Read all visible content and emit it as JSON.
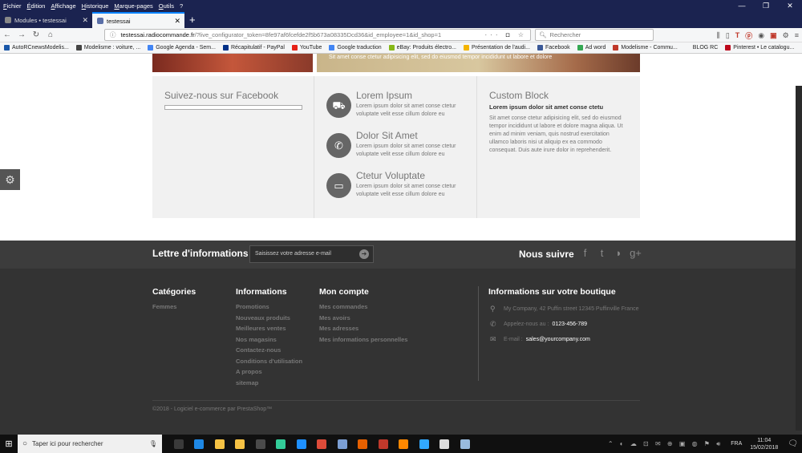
{
  "browser": {
    "menu": [
      "Fichier",
      "Édition",
      "Affichage",
      "Historique",
      "Marque-pages",
      "Outils",
      "?"
    ],
    "tabs": [
      {
        "label": "Modules • testessai",
        "active": false
      },
      {
        "label": "testessai",
        "active": true
      }
    ],
    "url_host": "testessai.radiocommande.fr",
    "url_path": "/?live_configurator_token=8fe97af6fcefde2f5b673a08335Dcd36&id_employee=1&id_shop=1",
    "search_placeholder": "Rechercher",
    "bookmarks": [
      {
        "label": "AutoRCnewsModelis...",
        "color": "#1a57a8"
      },
      {
        "label": "Modelisme : voiture, ...",
        "color": "#444"
      },
      {
        "label": "Google Agenda - Sem...",
        "color": "#4285f4"
      },
      {
        "label": "Récapitulatif - PayPal",
        "color": "#003087"
      },
      {
        "label": "YouTube",
        "color": "#e62117"
      },
      {
        "label": "Google traduction",
        "color": "#4285f4"
      },
      {
        "label": "eBay: Produits électro...",
        "color": "#86b817"
      },
      {
        "label": "Présentation de l'audi...",
        "color": "#f4b400"
      },
      {
        "label": "Facebook",
        "color": "#3b5998"
      },
      {
        "label": "Ad word",
        "color": "#34a853"
      },
      {
        "label": "Modelisme - Commu...",
        "color": "#c0392b"
      },
      {
        "label": "BLOG RC",
        "color": "#f5f6f7"
      },
      {
        "label": "Pinterest • Le catalogu...",
        "color": "#bd081c"
      }
    ]
  },
  "page": {
    "banner_text": "Sit amet conse ctetur adipisicing elit, sed do eiusmod tempor incididunt ut labore et dolore",
    "facebook_title": "Suivez-nous sur Facebook",
    "features": [
      {
        "icon": "truck-icon",
        "glyph": "⛟",
        "title": "Lorem Ipsum",
        "text": "Lorem ipsum dolor sit amet conse ctetur voluptate velit esse cillum dolore eu"
      },
      {
        "icon": "phone-icon",
        "glyph": "✆",
        "title": "Dolor Sit Amet",
        "text": "Lorem ipsum dolor sit amet conse ctetur voluptate velit esse cillum dolore eu"
      },
      {
        "icon": "credit-card-icon",
        "glyph": "▭",
        "title": "Ctetur Voluptate",
        "text": "Lorem ipsum dolor sit amet conse ctetur voluptate velit esse cillum dolore eu"
      }
    ],
    "custom_block": {
      "title": "Custom Block",
      "subtitle": "Lorem ipsum dolor sit amet conse ctetu",
      "text": "Sit amet conse ctetur adipisicing elit, sed do eiusmod tempor incididunt ut labore et dolore magna aliqua. Ut enim ad minim veniam, quis nostrud exercitation ullamco laboris nisi ut aliquip ex ea commodo consequat. Duis aute irure dolor in reprehenderit."
    },
    "newsletter": {
      "title": "Lettre d'informations",
      "placeholder": "Saisissez votre adresse e-mail"
    },
    "follow_title": "Nous suivre",
    "footer": {
      "categories": {
        "title": "Catégories",
        "links": [
          "Femmes"
        ]
      },
      "informations": {
        "title": "Informations",
        "links": [
          "Promotions",
          "Nouveaux produits",
          "Meilleures ventes",
          "Nos magasins",
          "Contactez-nous",
          "Conditions d'utilisation",
          "A propos",
          "sitemap"
        ]
      },
      "account": {
        "title": "Mon compte",
        "links": [
          "Mes commandes",
          "Mes avoirs",
          "Mes adresses",
          "Mes informations personnelles"
        ]
      },
      "store": {
        "title": "Informations sur votre boutique",
        "address": "My Company, 42 Puffin street 12345 Puffinville France",
        "phone_label": "Appelez-nous au :",
        "phone": "0123-456-789",
        "email_label": "E-mail :",
        "email": "sales@yourcompany.com"
      },
      "copyright": "©2018 - Logiciel e-commerce par PrestaShop™"
    }
  },
  "taskbar": {
    "search_placeholder": "Taper ici pour rechercher",
    "apps": [
      "#3a3a3a",
      "#1e88e5",
      "#f6c244",
      "#f6c244",
      "#4a4a4a",
      "#3c9",
      "#1e90ff",
      "#dd4b39",
      "#7b9fd4",
      "#e66000",
      "#c0392b",
      "#ff8800",
      "#31a8ff",
      "#ddd",
      "#9bd"
    ],
    "lang": "FRA",
    "time": "11:04",
    "date": "15/02/2018"
  }
}
